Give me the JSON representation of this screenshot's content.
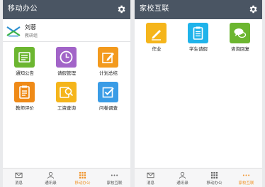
{
  "left_screen": {
    "header": {
      "title": "移动办公",
      "settings_icon": "gear-icon"
    },
    "profile": {
      "name": "刘蓉",
      "role": "教研组",
      "logo_icon": "school-logo-icon"
    },
    "apps": [
      {
        "label": "通知公告",
        "icon": "notice-icon",
        "color": "#6cb630"
      },
      {
        "label": "请假管理",
        "icon": "clock-icon",
        "color": "#a264c8"
      },
      {
        "label": "计划总结",
        "icon": "edit-icon",
        "color": "#f39a1e"
      },
      {
        "label": "教师评价",
        "icon": "document-icon",
        "color": "#ef8a17"
      },
      {
        "label": "工资查询",
        "icon": "search-card-icon",
        "color": "#f5b51b"
      },
      {
        "label": "问卷调查",
        "icon": "checkbox-icon",
        "color": "#3a9ce6"
      }
    ],
    "tabbar": [
      {
        "label": "消息",
        "icon": "mail-icon",
        "active": false
      },
      {
        "label": "通讯录",
        "icon": "person-icon",
        "active": false
      },
      {
        "label": "移动办公",
        "icon": "grid-icon",
        "active": true
      },
      {
        "label": "家校互联",
        "icon": "more-icon",
        "active": false
      }
    ]
  },
  "right_screen": {
    "header": {
      "title": "家校互联",
      "settings_icon": "gear-icon"
    },
    "apps": [
      {
        "label": "作业",
        "icon": "pencil-icon",
        "color": "#f5b51b"
      },
      {
        "label": "学生请假",
        "icon": "clipboard-icon",
        "color": "#1fb3ea"
      },
      {
        "label": "咨询回复",
        "icon": "chat-icon",
        "color": "#6cb630"
      }
    ],
    "tabbar": [
      {
        "label": "消息",
        "icon": "mail-icon",
        "active": false
      },
      {
        "label": "通讯录",
        "icon": "person-icon",
        "active": false
      },
      {
        "label": "移动办公",
        "icon": "grid-icon",
        "active": false
      },
      {
        "label": "家校互联",
        "icon": "more-icon",
        "active": true
      }
    ]
  },
  "colors": {
    "header": "#4a5563",
    "active_tab": "#f0932b"
  }
}
